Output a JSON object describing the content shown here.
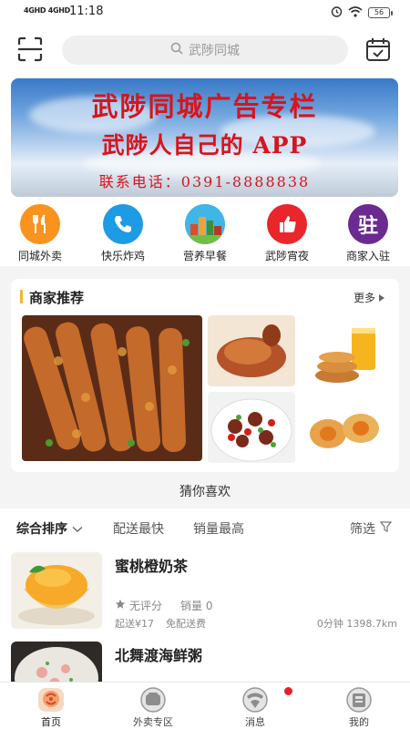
{
  "status_bar": {
    "signal_text": "4GHD 4GHD",
    "time": "11:18",
    "battery": "56"
  },
  "header": {
    "search_placeholder": "武陟同城"
  },
  "banner": {
    "line1": "武陟同城广告专栏",
    "line2": "武陟人自己的 APP",
    "line3": "联系电话：0391-8888838"
  },
  "categories": [
    {
      "label": "同城外卖",
      "icon": "fork-knife-icon",
      "color": "#f7931e"
    },
    {
      "label": "快乐炸鸡",
      "icon": "phone-icon",
      "color": "#1d9be5"
    },
    {
      "label": "营养早餐",
      "icon": "city-icon",
      "color": "#2aa6d8"
    },
    {
      "label": "武陟宵夜",
      "icon": "thumbs-up-icon",
      "color": "#e9262c"
    },
    {
      "label": "商家入驻",
      "icon": "zhu-glyph-icon",
      "color": "#6b2a91",
      "glyph": "驻"
    }
  ],
  "recommend": {
    "title": "商家推荐",
    "more": "更多"
  },
  "guess_label": "猜你喜欢",
  "sort_bar": {
    "options": [
      "综合排序",
      "配送最快",
      "销量最高"
    ],
    "filter": "筛选"
  },
  "shops": [
    {
      "name": "蜜桃橙奶茶",
      "rating": "无评分",
      "sales": "销量 0",
      "min_order": "起送¥17",
      "delivery_fee": "免配送费",
      "distance": "0分钟 1398.7km"
    },
    {
      "name": "北舞渡海鲜粥"
    }
  ],
  "tabs": [
    {
      "label": "首页",
      "icon": "home-icon"
    },
    {
      "label": "外卖专区",
      "icon": "takeout-icon"
    },
    {
      "label": "消息",
      "icon": "message-icon"
    },
    {
      "label": "我的",
      "icon": "profile-icon"
    }
  ]
}
